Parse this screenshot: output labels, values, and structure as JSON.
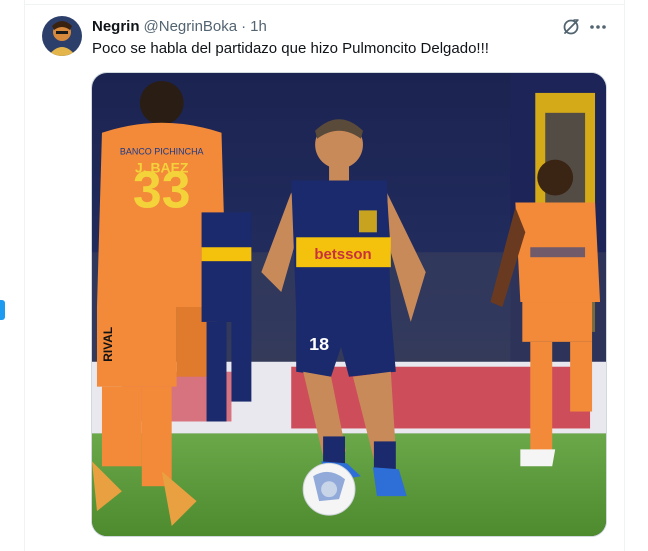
{
  "tweet": {
    "display_name": "Negrin",
    "handle": "@NegrinBoka",
    "separator": "·",
    "time": "1h",
    "text": "Poco se habla del partidazo que hizo Pulmoncito Delgado!!!",
    "avatar_icon": "user-avatar",
    "grok_icon": "grok-icon",
    "more_icon": "more-icon",
    "media": {
      "kind": "photo",
      "description_icon": "soccer-photo",
      "jersey_sponsor_left": "BANCO PICHINCHA",
      "player_name_left": "J. BAEZ",
      "player_number_left": "33",
      "jersey_sponsor_center": "betsson",
      "player_number_center": "18",
      "sleeve_text": "RIVAL"
    }
  },
  "colors": {
    "text_primary": "#0f1419",
    "text_secondary": "#536471",
    "border": "#cfd9de",
    "accent": "#1d9bf0",
    "boca_blue": "#1a2a6c",
    "boca_gold": "#f4c20d",
    "opponent_orange": "#f28a3a",
    "pitch_green": "#5d9a3a"
  }
}
